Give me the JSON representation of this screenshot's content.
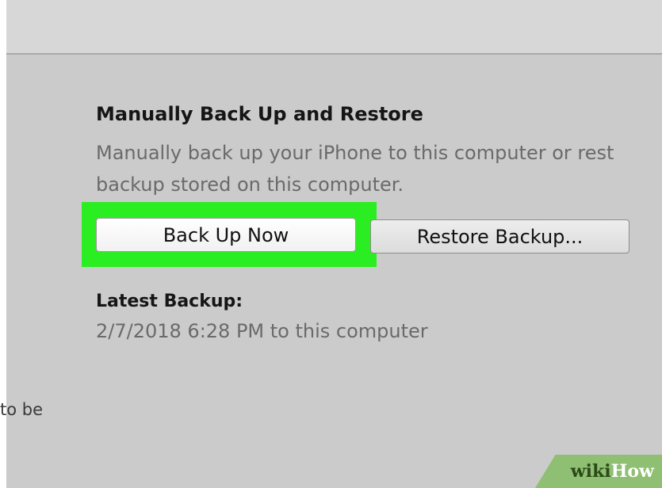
{
  "section": {
    "title": "Manually Back Up and Restore",
    "description_line1": "Manually back up your iPhone to this computer or rest",
    "description_line2": "backup stored on this computer."
  },
  "buttons": {
    "backup_now": "Back Up Now",
    "restore_backup": "Restore Backup..."
  },
  "latest_backup": {
    "title": "Latest Backup:",
    "value": "2/7/2018 6:28 PM to this computer"
  },
  "side_text": "to be",
  "watermark": {
    "wiki": "wiki",
    "how": "How"
  },
  "colors": {
    "highlight": "#2bee22",
    "panel": "#cbcbcb",
    "watermark_bg": "#8fbf72"
  }
}
